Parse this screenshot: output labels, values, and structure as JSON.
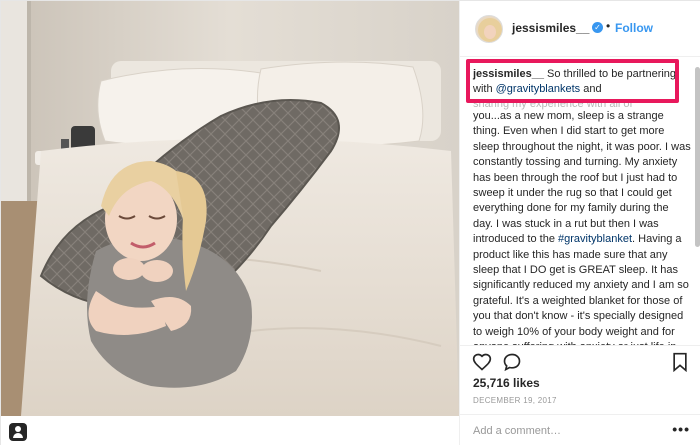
{
  "post": {
    "username": "jessismiles__",
    "verified_glyph": "✓",
    "separator": "•",
    "follow_label": "Follow",
    "caption": {
      "username": "jessismiles__",
      "text_before_mention": " So thrilled to be partnering with ",
      "mention": "@gravityblankets",
      "text_after_mention": " and",
      "faded_line": "sharing my experience with all of",
      "body_part1": "you...as a new mom, sleep is a strange thing. Even when I did start to get more sleep throughout the night, it was poor. I was constantly tossing and turning. My anxiety has been through the roof but I just had to sweep it under the rug so that I could get everything done for my family during the day. I was stuck in a rut but then I was introduced to the ",
      "hashtag": "#gravityblanket",
      "body_part2": ". Having a product like this has made sure that any sleep that I DO get is GREAT sleep. It has significantly reduced my anxiety and I am so grateful. It's a weighted blanket for those of you that don't know - it's specially designed to weigh 10% of your body weight and for anyone suffering with anxiety or just life in general, I"
    },
    "likes": "25,716 likes",
    "date": "DECEMBER 19, 2017",
    "comment_placeholder": "Add a comment…",
    "more_label": "•••"
  },
  "icons": {
    "avatar": "avatar-image",
    "verified": "verified-badge-icon",
    "like": "heart-icon",
    "comment": "comment-bubble-icon",
    "save": "bookmark-icon",
    "tag": "user-tag-icon"
  },
  "colors": {
    "link": "#3897f0",
    "mention": "#003569",
    "highlight": "#e8185c",
    "text": "#262626",
    "muted": "#999999"
  }
}
